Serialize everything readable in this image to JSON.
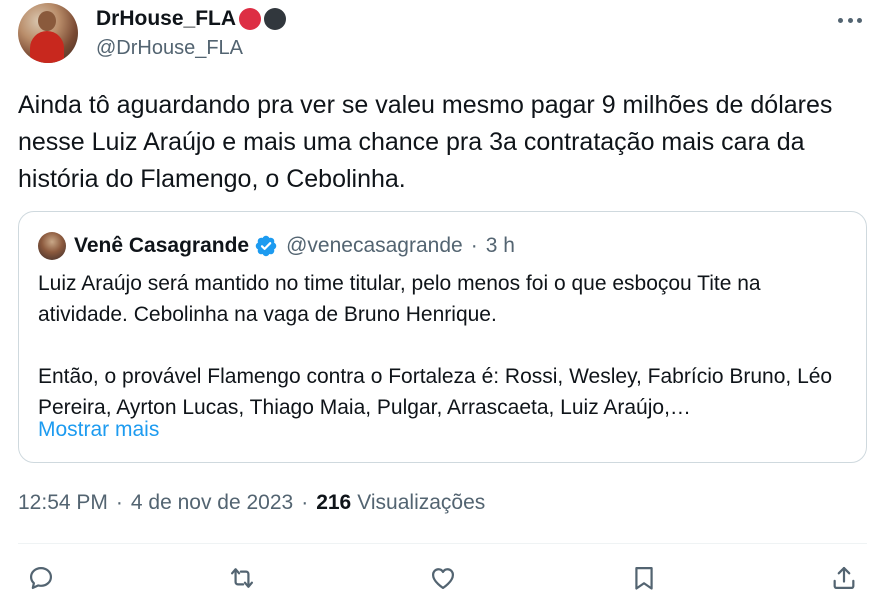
{
  "author": {
    "display_name": "DrHouse_FLA",
    "handle": "@DrHouse_FLA",
    "name_emojis": [
      "red-circle",
      "black-circle"
    ],
    "emoji_colors": {
      "red": "#dd2e44",
      "black": "#31373d"
    }
  },
  "tweet": {
    "text": "Ainda tô aguardando pra ver se valeu mesmo pagar 9 milhões de dólares nesse Luiz Araújo e mais uma chance pra 3a contratação mais cara da história do Flamengo, o Cebolinha."
  },
  "quote": {
    "name": "Venê Casagrande",
    "handle": "@venecasagrande",
    "separator": "·",
    "time": "3 h",
    "verified": true,
    "paragraph_1": "Luiz Araújo será mantido no time titular, pelo menos foi o que esboçou Tite na atividade. Cebolinha na vaga de Bruno Henrique.",
    "paragraph_2": "Então, o provável Flamengo contra o Fortaleza é: Rossi, Wesley, Fabrício Bruno, Léo Pereira, Ayrton Lucas, Thiago Maia, Pulgar, Arrascaeta, Luiz Araújo,…",
    "show_more": "Mostrar mais"
  },
  "meta": {
    "time": "12:54 PM",
    "separator": "·",
    "date": "4 de nov de 2023",
    "views_count": "216",
    "views_label": "Visualizações"
  },
  "actions": [
    "reply-icon",
    "retweet-icon",
    "like-icon",
    "bookmark-icon",
    "share-icon"
  ],
  "colors": {
    "text": "#0f1419",
    "secondary": "#536471",
    "link": "#1d9bf0",
    "border": "#cfd9de"
  }
}
